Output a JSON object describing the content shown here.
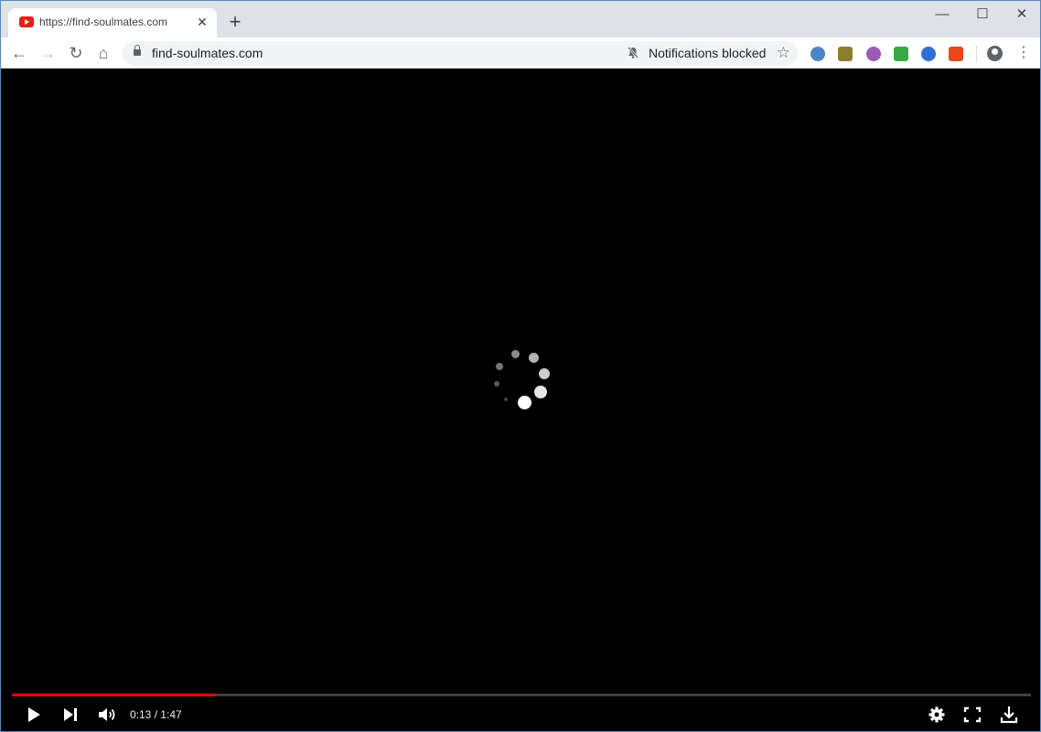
{
  "browser": {
    "tab": {
      "title": "https://find-soulmates.com",
      "favicon": "youtube-icon",
      "close_glyph": "✕"
    },
    "new_tab_glyph": "+",
    "window_controls": {
      "minimize": "—",
      "maximize": "☐",
      "close": "✕"
    },
    "nav": {
      "back": "←",
      "forward": "→",
      "reload": "↻",
      "home": "⌂"
    },
    "address": {
      "url": "find-soulmates.com",
      "lock": "lock-icon"
    },
    "notification": {
      "icon": "bell-off-icon",
      "text": "Notifications blocked"
    },
    "bookmark_glyph": "☆",
    "menu_glyph": "⋮",
    "extensions": [
      {
        "name": "search-extension-icon",
        "color": "#4a86c5"
      },
      {
        "name": "cc-extension-icon",
        "color": "#8d7d2f"
      },
      {
        "name": "game-extension-icon",
        "color": "#9c5ab8"
      },
      {
        "name": "green-extension-icon",
        "color": "#3aa845"
      },
      {
        "name": "sync-extension-icon",
        "color": "#2f6fd6"
      },
      {
        "name": "shield-extension-icon",
        "color": "#e8481c"
      }
    ]
  },
  "player": {
    "time": "0:13 / 1:47",
    "progress_fraction": 0.2,
    "progress_color": "#ff0000",
    "icons": [
      "play-icon",
      "next-icon",
      "volume-icon",
      "settings-icon",
      "fullscreen-icon",
      "download-icon"
    ]
  }
}
